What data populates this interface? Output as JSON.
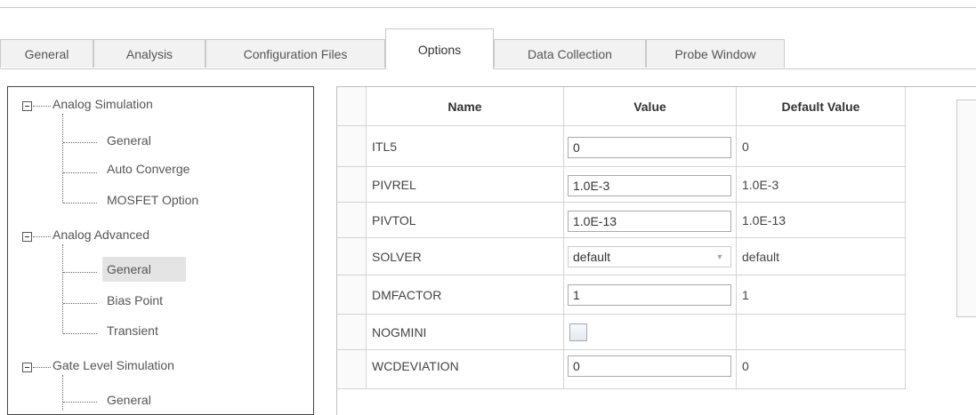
{
  "tabs": [
    {
      "label": "General"
    },
    {
      "label": "Analysis"
    },
    {
      "label": "Configuration Files"
    },
    {
      "label": "Options",
      "active": true
    },
    {
      "label": "Data Collection"
    },
    {
      "label": "Probe Window"
    }
  ],
  "tree": {
    "groups": [
      {
        "label": "Analog Simulation",
        "children": [
          "General",
          "Auto Converge",
          "MOSFET Option"
        ]
      },
      {
        "label": "Analog Advanced",
        "children": [
          "General",
          "Bias Point",
          "Transient"
        ],
        "selected_child": 0
      },
      {
        "label": "Gate Level Simulation",
        "children": [
          "General"
        ]
      }
    ]
  },
  "grid": {
    "headers": {
      "name": "Name",
      "value": "Value",
      "default": "Default Value"
    },
    "rows": [
      {
        "name": "ITL5",
        "value": "0",
        "default": "0",
        "editor": "text"
      },
      {
        "name": "PIVREL",
        "value": "1.0E-3",
        "default": "1.0E-3",
        "editor": "text"
      },
      {
        "name": "PIVTOL",
        "value": "1.0E-13",
        "default": "1.0E-13",
        "editor": "text"
      },
      {
        "name": "SOLVER",
        "value": "default",
        "default": "default",
        "editor": "combo"
      },
      {
        "name": "DMFACTOR",
        "value": "1",
        "default": "1",
        "editor": "text"
      },
      {
        "name": "NOGMINI",
        "value": "",
        "default": "",
        "editor": "checkbox",
        "checked": false
      },
      {
        "name": "WCDEVIATION",
        "value": "0",
        "default": "0",
        "editor": "text"
      }
    ]
  },
  "icons": {
    "expander": "collapse-icon",
    "combo": "chevron-down-icon"
  }
}
